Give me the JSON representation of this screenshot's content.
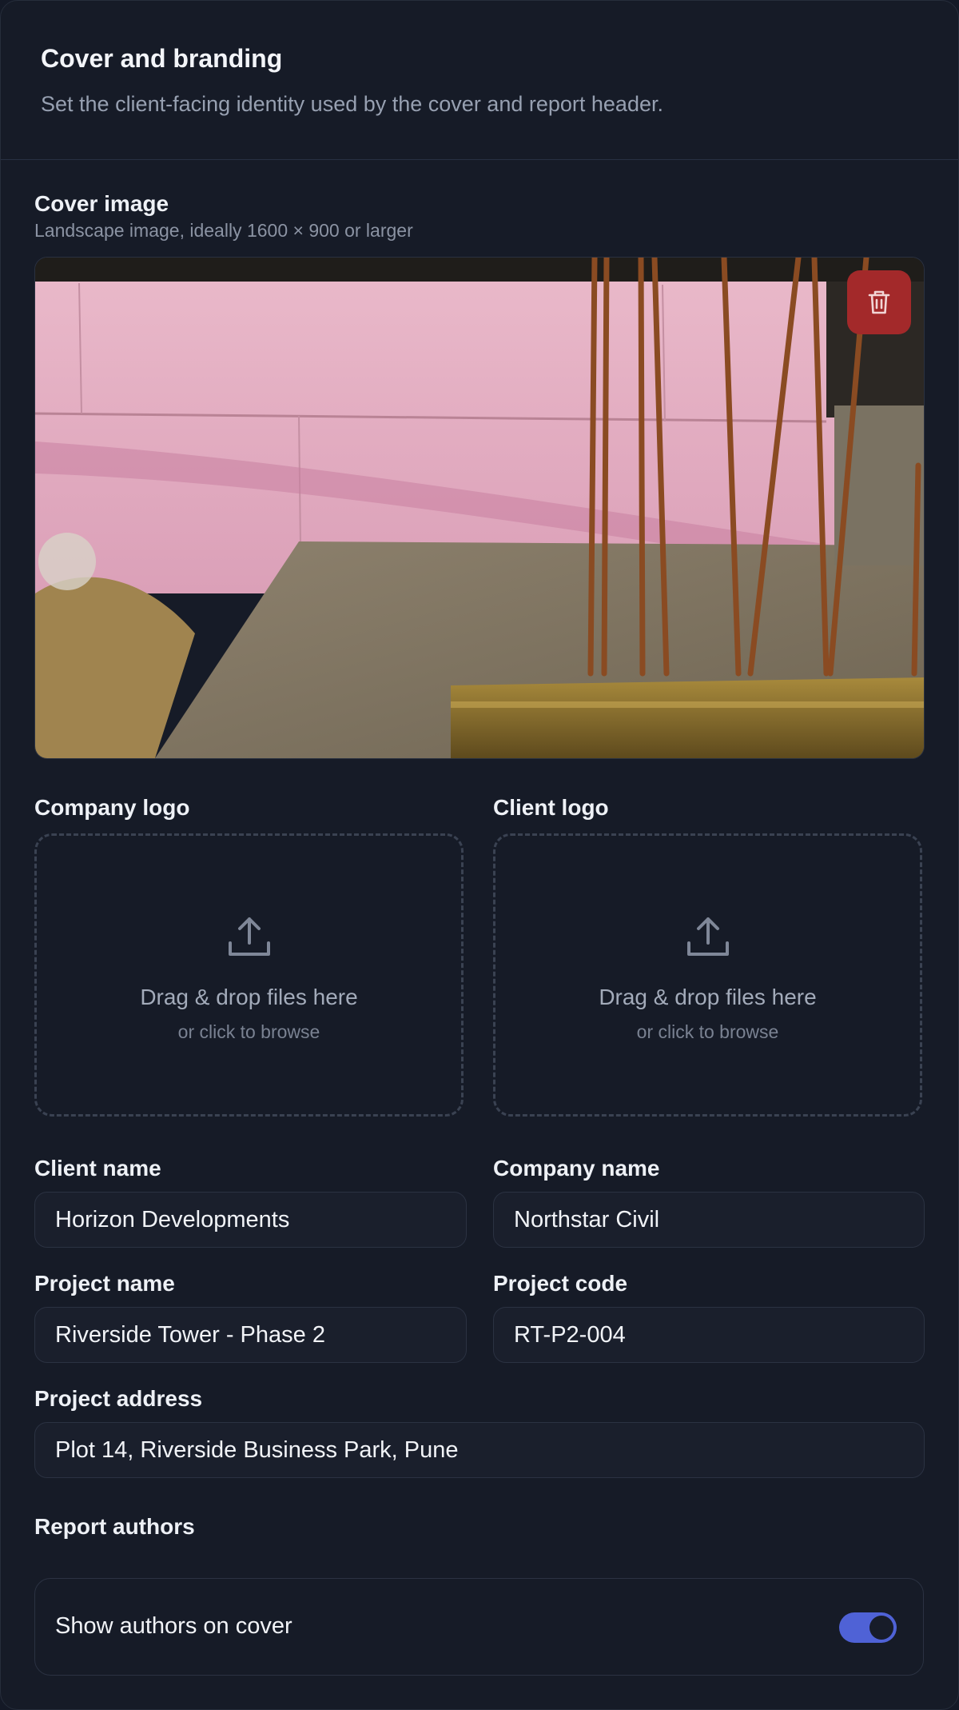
{
  "header": {
    "title": "Cover and branding",
    "subtitle": "Set the client-facing identity used by the cover and report header."
  },
  "cover_image": {
    "label": "Cover image",
    "hint": "Landscape image, ideally 1600 × 900 or larger",
    "delete_icon": "trash-icon"
  },
  "company_logo": {
    "label": "Company logo",
    "drop_text": "Drag & drop files here",
    "browse_text": "or click to browse",
    "icon": "upload-icon"
  },
  "client_logo": {
    "label": "Client logo",
    "drop_text": "Drag & drop files here",
    "browse_text": "or click to browse",
    "icon": "upload-icon"
  },
  "fields": {
    "client_name": {
      "label": "Client name",
      "value": "Horizon Developments"
    },
    "company_name": {
      "label": "Company name",
      "value": "Northstar Civil"
    },
    "project_name": {
      "label": "Project name",
      "value": "Riverside Tower - Phase 2"
    },
    "project_code": {
      "label": "Project code",
      "value": "RT-P2-004"
    },
    "project_address": {
      "label": "Project address",
      "value": "Plot 14, Riverside Business Park, Pune"
    }
  },
  "authors": {
    "section_label": "Report authors",
    "toggle_label": "Show authors on cover",
    "toggle_on": true
  },
  "colors": {
    "background": "#161b27",
    "accent": "#4f62d6",
    "danger": "#a3292a"
  }
}
